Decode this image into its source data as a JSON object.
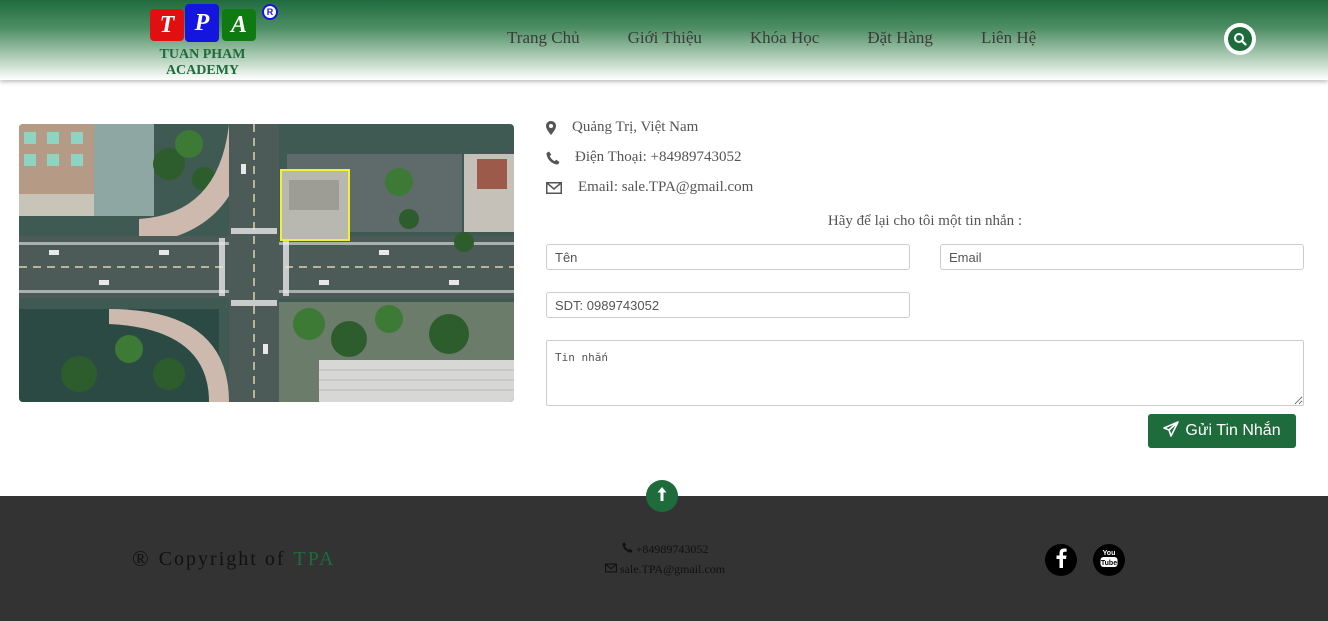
{
  "header": {
    "logo": {
      "letters": [
        "T",
        "P",
        "A"
      ],
      "registered": "R",
      "name_line1": "TUAN PHAM",
      "name_line2": "ACADEMY"
    },
    "nav": [
      "Trang Chủ",
      "Giới Thiệu",
      "Khóa Học",
      "Đặt Hàng",
      "Liên Hệ"
    ],
    "search_icon": "search-icon"
  },
  "contact": {
    "address": "Quảng Trị, Việt Nam",
    "phone": "Điện Thoại: +84989743052",
    "email": "Email: sale.TPA@gmail.com",
    "prompt": "Hãy để lại cho tôi một tin nhắn :"
  },
  "form": {
    "name_placeholder": "Tên",
    "email_placeholder": "Email",
    "phone_placeholder": "SDT: 0989743052",
    "message_placeholder": "Tin nhắn",
    "send_label": "Gửi Tin Nhắn"
  },
  "footer": {
    "copyright_symbol": "®",
    "copyright_text": "Copyright of",
    "brand": "TPA",
    "phone": "+84989743052",
    "email": "sale.TPA@gmail.com",
    "social": [
      "facebook-icon",
      "youtube-icon"
    ]
  },
  "colors": {
    "brand_green": "#1e6b3c",
    "footer_bg": "#333333"
  }
}
